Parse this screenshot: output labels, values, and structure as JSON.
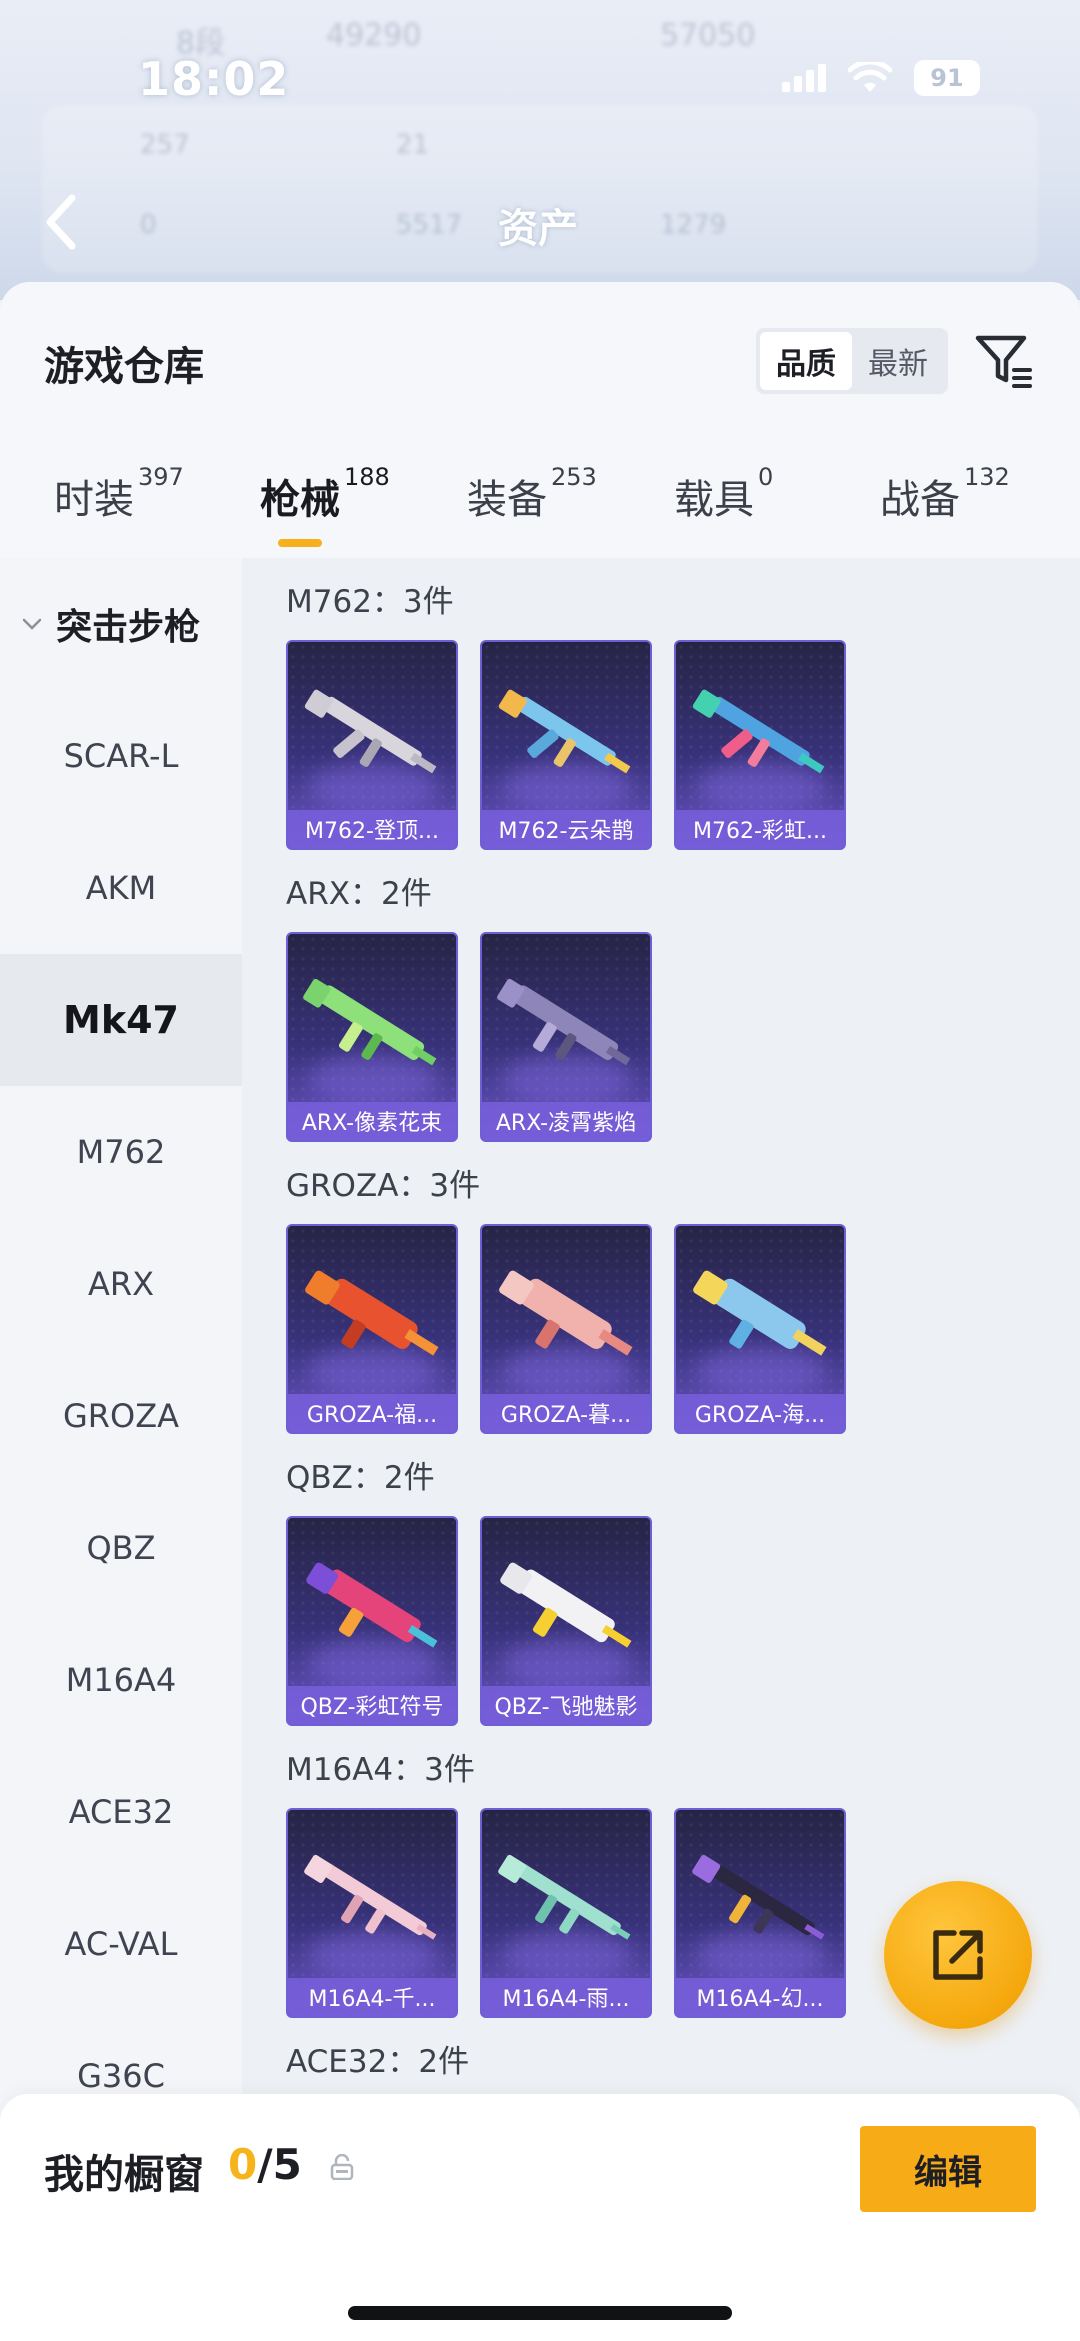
{
  "status_bar": {
    "time": "18:02",
    "battery": "91"
  },
  "background": {
    "rank_text": "8段",
    "coins_a": "49290",
    "coins_b": "57050",
    "stat_1": "257",
    "stat_2": "21",
    "stat_3": "0",
    "stat_4": "5517",
    "stat_5": "1279",
    "title": "资产"
  },
  "sheet": {
    "title": "游戏仓库",
    "sort": {
      "options": [
        "品质",
        "最新"
      ],
      "active": "品质"
    }
  },
  "tabs": [
    {
      "label": "时装",
      "count": "397"
    },
    {
      "label": "枪械",
      "count": "188",
      "active": true
    },
    {
      "label": "装备",
      "count": "253"
    },
    {
      "label": "载具",
      "count": "0"
    },
    {
      "label": "战备",
      "count": "132"
    }
  ],
  "side_nav": {
    "group": "突击步枪",
    "items": [
      "SCAR-L",
      "AKM",
      "Mk47",
      "M762",
      "ARX",
      "GROZA",
      "QBZ",
      "M16A4",
      "ACE32",
      "AC-VAL",
      "G36C"
    ],
    "active": "Mk47"
  },
  "groups": [
    {
      "title": "M762：3件",
      "items": [
        "M762-登顶...",
        "M762-云朵鹊",
        "M762-彩虹..."
      ]
    },
    {
      "title": "ARX：2件",
      "items": [
        "ARX-像素花束",
        "ARX-凌霄紫焰"
      ]
    },
    {
      "title": "GROZA：3件",
      "items": [
        "GROZA-福...",
        "GROZA-暮...",
        "GROZA-海..."
      ]
    },
    {
      "title": "QBZ：2件",
      "items": [
        "QBZ-彩虹符号",
        "QBZ-飞驰魅影"
      ]
    },
    {
      "title": "M16A4：3件",
      "items": [
        "M16A4-千...",
        "M16A4-雨...",
        "M16A4-幻..."
      ]
    },
    {
      "title": "ACE32：2件",
      "items": []
    }
  ],
  "bottom_bar": {
    "label": "我的橱窗",
    "current": "0",
    "total": "/5",
    "edit_label": "编辑"
  },
  "colors": {
    "accent": "#f6b41a",
    "card_bg": "#38327a",
    "card_label": "#785fdc"
  }
}
